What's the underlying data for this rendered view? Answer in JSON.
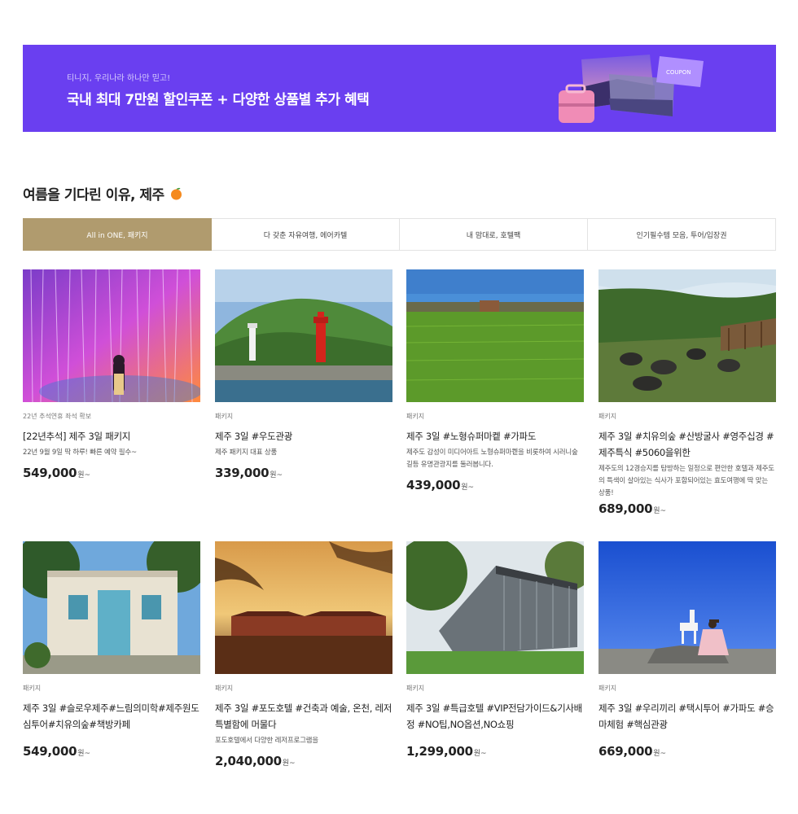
{
  "banner": {
    "small_text": "티니지, 우리나라 하나만 믿고!",
    "title": "국내 최대 7만원 할인쿠폰 + 다양한 상품별 추가 혜택",
    "coupon_label": "COUPON"
  },
  "section": {
    "title": "여름을 기다린 이유, 제주"
  },
  "tabs": [
    {
      "label": "All in ONE, 패키지",
      "active": true
    },
    {
      "label": "다 갖춘 자유여행, 에어카텔",
      "active": false
    },
    {
      "label": "내 맘대로, 호텔팩",
      "active": false
    },
    {
      "label": "인기필수템 모음, 투어/입장권",
      "active": false
    }
  ],
  "products": [
    {
      "tag": "22년 추석연휴 좌석 확보",
      "title": "[22년추석] 제주 3일 패키지",
      "desc": "22년 9월 9일 딱 하루! 빠른 예약 필수~",
      "price": "549,000",
      "unit": "원~",
      "image": "light-installation"
    },
    {
      "tag": "패키지",
      "title": "제주 3일 #우도관광",
      "desc": "제주 패키지 대표 상품",
      "price": "339,000",
      "unit": "원~",
      "image": "lighthouse"
    },
    {
      "tag": "패키지",
      "title": "제주 3일 #노형슈퍼마켙 #가파도",
      "desc": "제주도 감성이 미디어아트 노형슈퍼마켙을 비롯하여 시러니숲길등 유명관광지를 둘러봅니다.",
      "price": "439,000",
      "unit": "원~",
      "image": "green-field"
    },
    {
      "tag": "패키지",
      "title": "제주 3일 #치유의숲 #산방굴사 #영주십경 #제주특식 #5060을위한",
      "desc": "제주도의 12경승지를 탐방하는 일정으로 편안한 호텔과 제주도의 특색이 살아있는 식사가 포함되어있는 효도여행에 딱 맞는 상품!",
      "price": "689,000",
      "unit": "원~",
      "image": "rock-forest"
    },
    {
      "tag": "패키지",
      "title": "제주 3일 #슬로우제주#느림의미학#제주원도심투어#치유의숲#책방카페",
      "desc": "",
      "price": "549,000",
      "unit": "원~",
      "image": "cafe-building"
    },
    {
      "tag": "패키지",
      "title": "제주 3일 #포도호텔 #건축과 예술, 온천, 레저 특별함에 머물다",
      "desc": "포도호텔에서 다양한 레저프로그램을",
      "price": "2,040,000",
      "unit": "원~",
      "image": "sunset-hotel"
    },
    {
      "tag": "패키지",
      "title": "제주 3일 #특급호텔 #VIP전담가이드&기사배정 #NO팁,NO옵션,NO쇼핑",
      "desc": "",
      "price": "1,299,000",
      "unit": "원~",
      "image": "glass-building"
    },
    {
      "tag": "패키지",
      "title": "제주 3일 #우리끼리 #택시투어 #가파도 #승마체험 #핵심관광",
      "desc": "",
      "price": "669,000",
      "unit": "원~",
      "image": "beach-horse"
    }
  ],
  "colors": {
    "banner_bg": "#6a3ff0",
    "tab_active_bg": "#b09b6e"
  }
}
